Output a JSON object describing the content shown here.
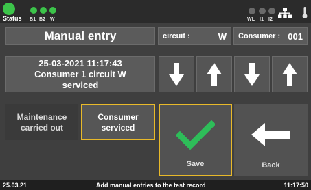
{
  "status_bar": {
    "status_label": "Status",
    "leds_left": [
      {
        "label": "B1",
        "state": "on"
      },
      {
        "label": "B2",
        "state": "on"
      },
      {
        "label": "W",
        "state": "on"
      }
    ],
    "leds_right": [
      {
        "label": "WL",
        "state": "off"
      },
      {
        "label": "I1",
        "state": "off"
      },
      {
        "label": "I2",
        "state": "off"
      }
    ],
    "icons": [
      "network-icon",
      "thermometer-icon"
    ],
    "colors": {
      "led_on": "#3cc44a",
      "led_off": "#6a6a6a"
    }
  },
  "header": {
    "title": "Manual  entry",
    "circuit_label": "circuit :",
    "circuit_value": "W",
    "consumer_label": "Consumer :",
    "consumer_value": "001"
  },
  "record": {
    "line1": "25-03-2021 11:17:43",
    "line2": "Consumer 1 circuit  W",
    "line3": "serviced"
  },
  "arrows": [
    "arrow-down-icon",
    "arrow-up-icon",
    "arrow-down-icon",
    "arrow-up-icon"
  ],
  "options": {
    "maintenance_line1": "Maintenance",
    "maintenance_line2": "carried out",
    "consumer_line1": "Consumer",
    "consumer_line2": "serviced",
    "selected": "consumer"
  },
  "actions": {
    "save_label": "Save",
    "back_label": "Back",
    "accent_color": "#e8b92a",
    "check_color": "#2ebd59"
  },
  "footer": {
    "date": "25.03.21",
    "message": "Add manual entries to the test record",
    "time": "11:17:50"
  }
}
